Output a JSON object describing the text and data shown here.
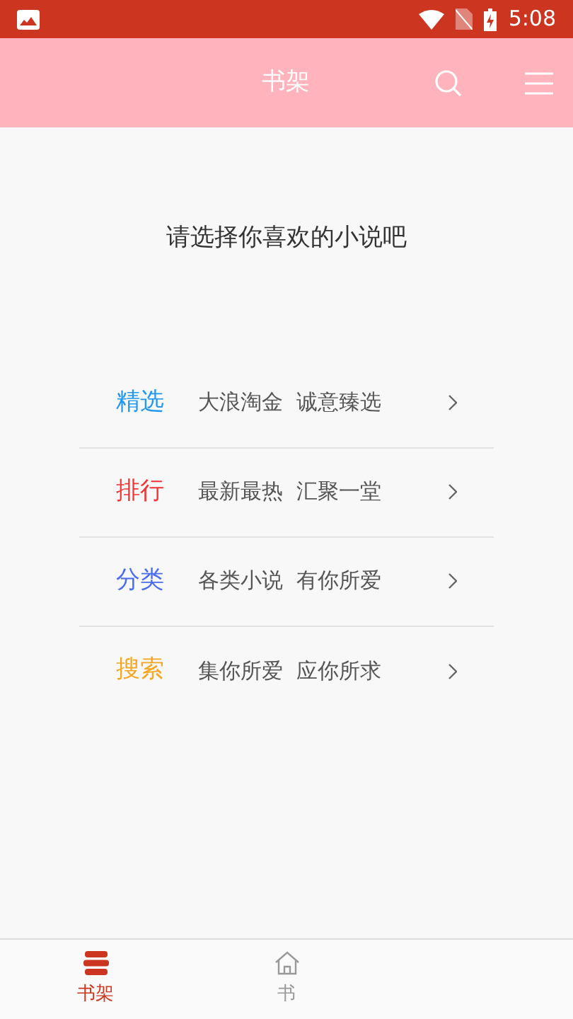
{
  "status_bar": {
    "time": "5:08"
  },
  "header": {
    "title": "书架"
  },
  "prompt": "请选择你喜欢的小说吧",
  "categories": [
    {
      "title": "精选",
      "subtitle": "大浪淘金  诚意臻选",
      "color": "#2196f3"
    },
    {
      "title": "排行",
      "subtitle": "最新最热  汇聚一堂",
      "color": "#f03333"
    },
    {
      "title": "分类",
      "subtitle": "各类小说  有你所爱",
      "color": "#4a6cf0"
    },
    {
      "title": "搜索",
      "subtitle": "集你所爱  应你所求",
      "color": "#f5a623"
    }
  ],
  "bottom_nav": [
    {
      "label": "书架",
      "kind": "shelf",
      "selected": true
    },
    {
      "label": "书",
      "kind": "home",
      "selected": false
    }
  ]
}
